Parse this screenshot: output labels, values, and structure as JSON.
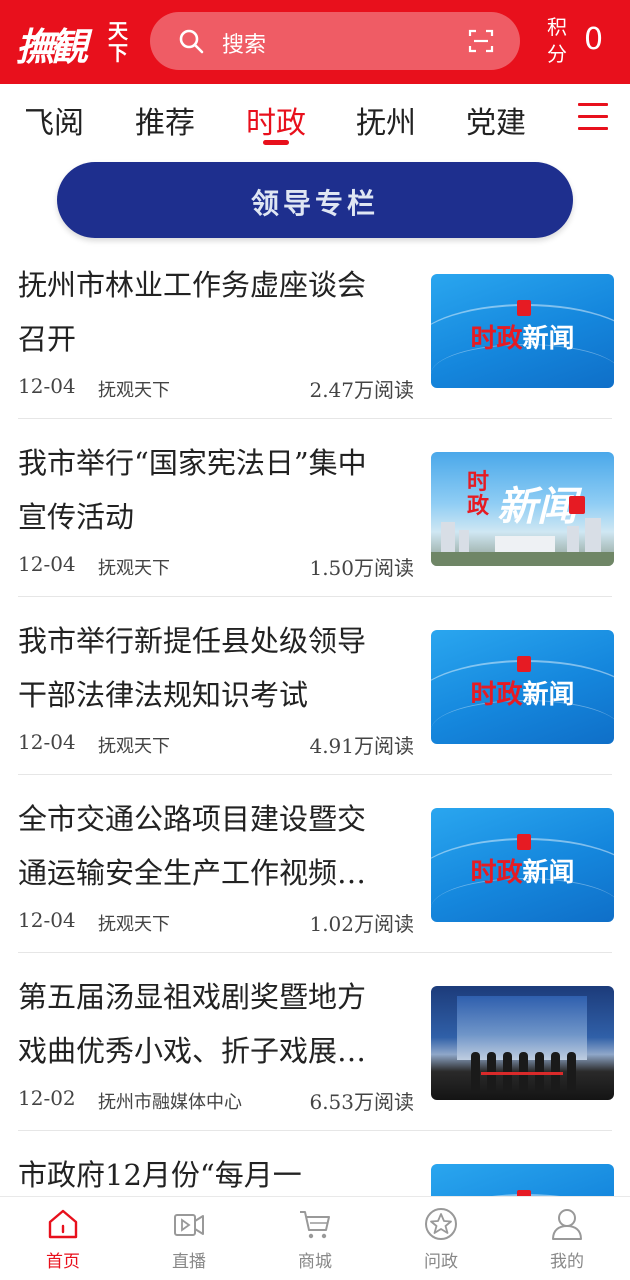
{
  "header": {
    "logo_main": "撫観",
    "logo_small": "天下",
    "search_placeholder": "搜索",
    "points_label": "积分",
    "points_value": "0",
    "color": "#e8101c"
  },
  "tabs": [
    {
      "label": "飞阅",
      "active": false
    },
    {
      "label": "推荐",
      "active": false
    },
    {
      "label": "时政",
      "active": true
    },
    {
      "label": "抚州",
      "active": false
    },
    {
      "label": "党建",
      "active": false
    }
  ],
  "banner": {
    "label": "领导专栏"
  },
  "thumb_labels": {
    "shi": "时",
    "zheng": "政",
    "xinwen": "新闻",
    "xin_wen_big": "新闻"
  },
  "feed": [
    {
      "title": "抚州市林业工作务虚座谈会召开",
      "date": "12-04",
      "source": "抚观天下",
      "reads": "2.47万阅读",
      "thumb": "blue"
    },
    {
      "title": "我市举行“国家宪法日”集中宣传活动",
      "date": "12-04",
      "source": "抚观天下",
      "reads": "1.50万阅读",
      "thumb": "city"
    },
    {
      "title": "我市举行新提任县处级领导干部法律法规知识考试",
      "date": "12-04",
      "source": "抚观天下",
      "reads": "4.91万阅读",
      "thumb": "blue"
    },
    {
      "title": "全市交通公路项目建设暨交通运输安全生产工作视频…",
      "date": "12-04",
      "source": "抚观天下",
      "reads": "1.02万阅读",
      "thumb": "blue"
    },
    {
      "title": "第五届汤显祖戏剧奖暨地方戏曲优秀小戏、折子戏展…",
      "date": "12-02",
      "source": "抚州市融媒体中心",
      "reads": "6.53万阅读",
      "thumb": "stage"
    },
    {
      "title": "市政府12月份“每月一",
      "date": "",
      "source": "",
      "reads": "",
      "thumb": "blue"
    }
  ],
  "bottom_nav": [
    {
      "label": "首页",
      "icon": "home-icon",
      "active": true
    },
    {
      "label": "直播",
      "icon": "video-icon",
      "active": false
    },
    {
      "label": "商城",
      "icon": "cart-icon",
      "active": false
    },
    {
      "label": "问政",
      "icon": "star-icon",
      "active": false
    },
    {
      "label": "我的",
      "icon": "user-icon",
      "active": false
    }
  ]
}
